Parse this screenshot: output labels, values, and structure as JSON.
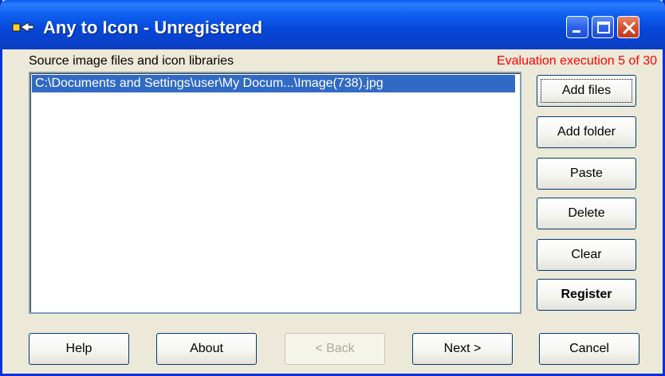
{
  "window": {
    "title": "Any to Icon - Unregistered",
    "icons": {
      "app": "app-icon",
      "minimize": "minimize-icon",
      "maximize": "maximize-icon",
      "close": "close-icon"
    }
  },
  "main": {
    "source_label": "Source image files and icon libraries",
    "evaluation_text": "Evaluation execution 5 of 30",
    "evaluation_color": "#ff0000",
    "files": [
      "C:\\Documents and Settings\\user\\My Docum...\\Image(738).jpg"
    ],
    "selection_color": "#316ac5"
  },
  "side_buttons": {
    "add_files": "Add files",
    "add_folder": "Add folder",
    "paste": "Paste",
    "delete": "Delete",
    "clear": "Clear",
    "register": "Register"
  },
  "footer_buttons": {
    "help": "Help",
    "about": "About",
    "back": "< Back",
    "next": "Next >",
    "cancel": "Cancel"
  }
}
